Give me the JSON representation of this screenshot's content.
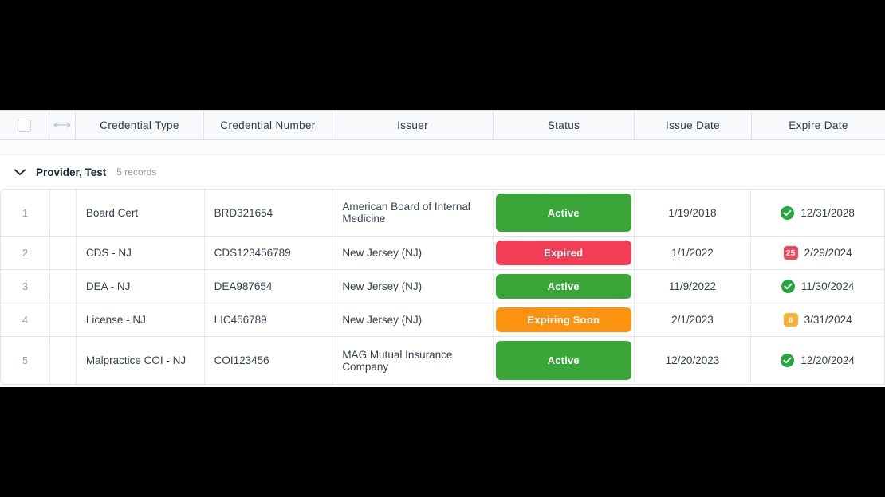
{
  "grid": {
    "header": {
      "select_all_label": "",
      "resize_handle_label": "",
      "columns": [
        {
          "key": "credential_type",
          "label": "Credential Type"
        },
        {
          "key": "credential_number",
          "label": "Credential Number"
        },
        {
          "key": "issuer",
          "label": "Issuer"
        },
        {
          "key": "status",
          "label": "Status"
        },
        {
          "key": "issue_date",
          "label": "Issue Date"
        },
        {
          "key": "expire_date",
          "label": "Expire Date"
        }
      ]
    },
    "group": {
      "name": "Provider, Test",
      "record_count": "5 records",
      "expanded": true
    },
    "rows": [
      {
        "index": "1",
        "credential_type": "Board Cert",
        "credential_number": "BRD321654",
        "issuer": "American Board of Internal Medicine",
        "status": "Active",
        "status_color": "#3aa63a",
        "issue_date": "1/19/2018",
        "expire_date": "12/31/2028",
        "expire_icon": "check-circle-icon",
        "expire_icon_value": "",
        "expire_icon_color": "#22a83c"
      },
      {
        "index": "2",
        "credential_type": "CDS - NJ",
        "credential_number": "CDS123456789",
        "issuer": "New Jersey (NJ)",
        "status": "Expired",
        "status_color": "#f23d55",
        "issue_date": "1/1/2022",
        "expire_date": "2/29/2024",
        "expire_icon": "days-count-badge-icon",
        "expire_icon_value": "25",
        "expire_icon_color": "#f4485e"
      },
      {
        "index": "3",
        "credential_type": "DEA - NJ",
        "credential_number": "DEA987654",
        "issuer": "New Jersey (NJ)",
        "status": "Active",
        "status_color": "#3aa63a",
        "issue_date": "11/9/2022",
        "expire_date": "11/30/2024",
        "expire_icon": "check-circle-icon",
        "expire_icon_value": "",
        "expire_icon_color": "#22a83c"
      },
      {
        "index": "4",
        "credential_type": "License - NJ",
        "credential_number": "LIC456789",
        "issuer": "New Jersey (NJ)",
        "status": "Expiring Soon",
        "status_color": "#fb9310",
        "issue_date": "2/1/2023",
        "expire_date": "3/31/2024",
        "expire_icon": "days-count-badge-icon",
        "expire_icon_value": "6",
        "expire_icon_color": "#fcb034"
      },
      {
        "index": "5",
        "credential_type": "Malpractice COI - NJ",
        "credential_number": "COI123456",
        "issuer": "MAG Mutual Insurance Company",
        "status": "Active",
        "status_color": "#3aa63a",
        "issue_date": "12/20/2023",
        "expire_date": "12/20/2024",
        "expire_icon": "check-circle-icon",
        "expire_icon_value": "",
        "expire_icon_color": "#22a83c"
      }
    ]
  }
}
